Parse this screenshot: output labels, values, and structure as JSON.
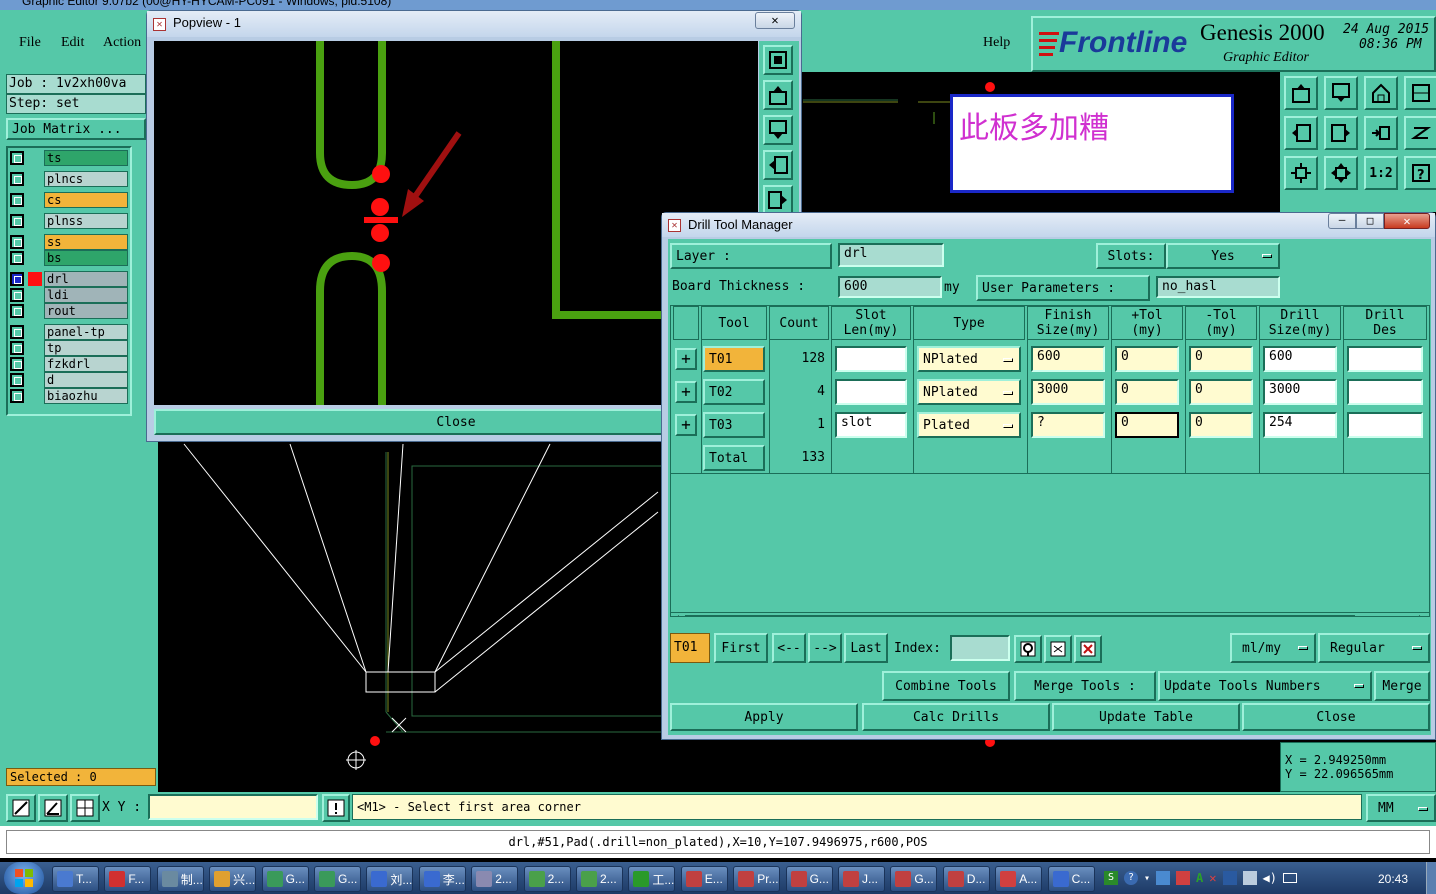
{
  "main_window": {
    "title": "Graphic Editor 9.07b2 (00@HY-HYCAM-PC091 - Windows, pid:5108)"
  },
  "menu": {
    "file": "File",
    "edit": "Edit",
    "action": "Action",
    "help": "Help"
  },
  "branding": {
    "logo": "Frontline",
    "product": "Genesis 2000",
    "subtitle": "Graphic Editor",
    "date": "24 Aug 2015",
    "time": "08:36 PM"
  },
  "job": {
    "job_label": "Job  :  1v2xh00va",
    "step_label": "Step:  set",
    "matrix_button": "Job Matrix ..."
  },
  "layers": [
    {
      "name": "ts",
      "color": "#2ea56a"
    },
    {
      "name": "plncs",
      "color": "#b8d4d0"
    },
    {
      "name": "cs",
      "color": "#f2b43a"
    },
    {
      "name": "plnss",
      "color": "#b8d4d0"
    },
    {
      "name": "ss",
      "color": "#f2b43a"
    },
    {
      "name": "bs",
      "color": "#2ea56a"
    },
    {
      "name": "drl",
      "color": "#a0b4b8"
    },
    {
      "name": "ldi",
      "color": "#a0b4b8"
    },
    {
      "name": "rout",
      "color": "#a0b4b8"
    },
    {
      "name": "panel-tp",
      "color": "#b8d4d0"
    },
    {
      "name": "tp",
      "color": "#b8d4d0"
    },
    {
      "name": "fzkdrl",
      "color": "#b8d4d0"
    },
    {
      "name": "d",
      "color": "#b8d4d0"
    },
    {
      "name": "biaozhu",
      "color": "#b8d4d0"
    }
  ],
  "selected": "Selected : 0",
  "popview": {
    "title": "Popview - 1",
    "close": "Close"
  },
  "note": "此板多加糟",
  "coords": {
    "x": "X  =  2.949250mm",
    "y": "Y  =  22.096565mm"
  },
  "drill_manager": {
    "title": "Drill Tool Manager",
    "layer_label": "Layer        :",
    "layer_value": "drl",
    "slots_label": "Slots:",
    "slots_value": "Yes",
    "thickness_label": "Board Thickness :",
    "thickness_value": "600",
    "thickness_unit": "my",
    "user_params_label": "User Parameters :",
    "user_params_value": "no_hasl",
    "headers": [
      "Tool",
      "Count",
      "Slot\nLen(my)",
      "Type",
      "Finish\nSize(my)",
      "+Tol\n(my)",
      "-Tol\n(my)",
      "Drill\nSize(my)",
      "Drill\nDes"
    ],
    "rows": [
      {
        "tool": "T01",
        "count": "128",
        "slot_len": "",
        "type": "NPlated",
        "finish": "600",
        "ptol": "0",
        "ntol": "0",
        "drill": "600",
        "des": ""
      },
      {
        "tool": "T02",
        "count": "4",
        "slot_len": "",
        "type": "NPlated",
        "finish": "3000",
        "ptol": "0",
        "ntol": "0",
        "drill": "3000",
        "des": ""
      },
      {
        "tool": "T03",
        "count": "1",
        "slot_len": "slot",
        "type": "Plated",
        "finish": "?",
        "ptol": "0",
        "ntol": "0",
        "drill": "254",
        "des": ""
      }
    ],
    "total_label": "Total",
    "total_count": "133",
    "nav": {
      "current": "T01",
      "first": "First",
      "prev": "<--",
      "next": "-->",
      "last": "Last",
      "index_label": "Index:",
      "units": "ml/my",
      "mode": "Regular"
    },
    "actions": {
      "combine": "Combine Tools",
      "merge_tools": "Merge Tools :",
      "update_numbers": "Update Tools Numbers",
      "merge": "Merge",
      "apply": "Apply",
      "calc": "Calc Drills",
      "update_table": "Update Table",
      "close": "Close"
    }
  },
  "command": {
    "xy_label": "X Y :",
    "prompt": "<M1> - Select first area corner",
    "units": "MM"
  },
  "status_line": "drl,#51,Pad(.drill=non_plated),X=10,Y=107.9496975,r600,POS",
  "taskbar": {
    "items": [
      "T...",
      "F...",
      "制...",
      "兴...",
      "G...",
      "G...",
      "刘...",
      "李...",
      "2...",
      "2...",
      "2...",
      "工...",
      "E...",
      "Pr...",
      "G...",
      "J...",
      "G...",
      "D...",
      "A...",
      "C..."
    ],
    "clock": "20:43"
  }
}
